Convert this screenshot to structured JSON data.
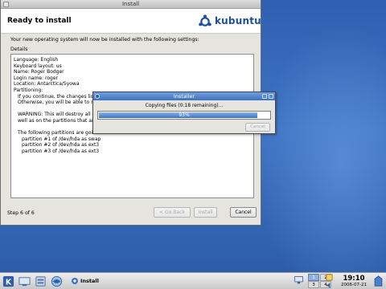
{
  "window": {
    "title": "Install",
    "heading": "Ready to install",
    "brand": "kubuntu",
    "intro": "Your new operating system will now be installed with the following settings:",
    "details_label": "Details",
    "details": [
      "Language: English",
      "Keyboard layout: us",
      "Name: Roger Bodger",
      "Login name: roger",
      "Location: Antarctica/Syowa",
      "Partitioning:",
      "If you continue, the changes liste",
      "Otherwise, you will be able to ma",
      "",
      "WARNING: This will destroy all dat",
      "well as on the partitions that are",
      "",
      "The following partitions are goin",
      "partition #1 of /dev/hda as swap",
      "partition #2 of /dev/hda as ext3",
      "partition #3 of /dev/hda as ext3"
    ],
    "step": "Step 6 of 6",
    "buttons": {
      "back": "< Go Back",
      "install": "Install",
      "cancel": "Cancel"
    }
  },
  "dialog": {
    "title": "Installer",
    "status": "Copying files (0:18 remaining)...",
    "progress_percent": 93,
    "progress_label": "93%",
    "cancel": "Cancel"
  },
  "taskbar": {
    "task_label": "Install",
    "pager": [
      "1",
      "2",
      "3",
      "4"
    ],
    "active_desktop": "1",
    "time": "19:10",
    "date": "2006-07-21"
  },
  "colors": {
    "desktop": "#3d74c4",
    "titlebar_active": "#3f72c3",
    "progress": "#3a6fc4",
    "brand": "#1e4f9c"
  },
  "icons": {
    "taskbar_launchers": [
      "kde-menu-icon",
      "desktop-icon",
      "system-icon",
      "konqueror-icon"
    ],
    "tray": [
      "network-icon",
      "updates-icon",
      "volume-icon",
      "kde-tray-icon"
    ]
  }
}
